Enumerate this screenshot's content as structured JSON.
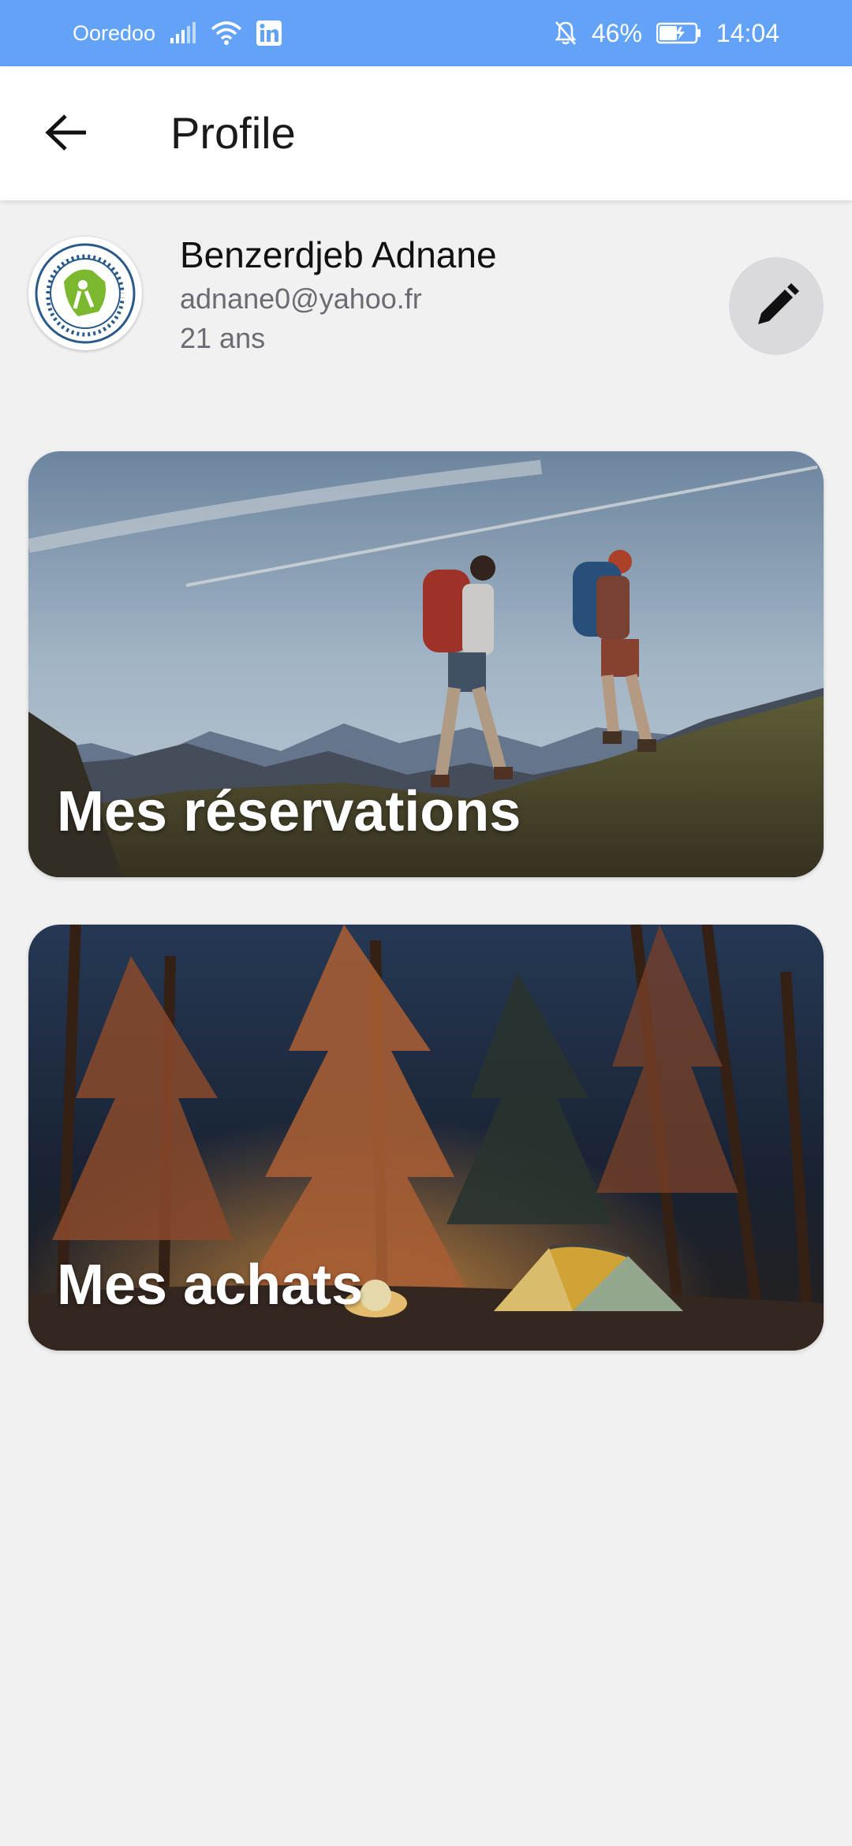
{
  "status_bar": {
    "carrier": "Ooredoo",
    "battery": "46%",
    "time": "14:04"
  },
  "app_bar": {
    "title": "Profile"
  },
  "profile": {
    "name": "Benzerdjeb Adnane",
    "email": "adnane0@yahoo.fr",
    "age": "21 ans"
  },
  "cards": {
    "reservations": "Mes réservations",
    "achats": "Mes achats"
  },
  "colors": {
    "status_bar": "#62a3f7",
    "background": "#f1f1f1",
    "edit_button": "#d9d9de"
  },
  "icons": [
    "signal-icon",
    "wifi-icon",
    "linkedin-icon",
    "mute-icon",
    "battery-icon",
    "back-arrow-icon",
    "pencil-icon"
  ]
}
